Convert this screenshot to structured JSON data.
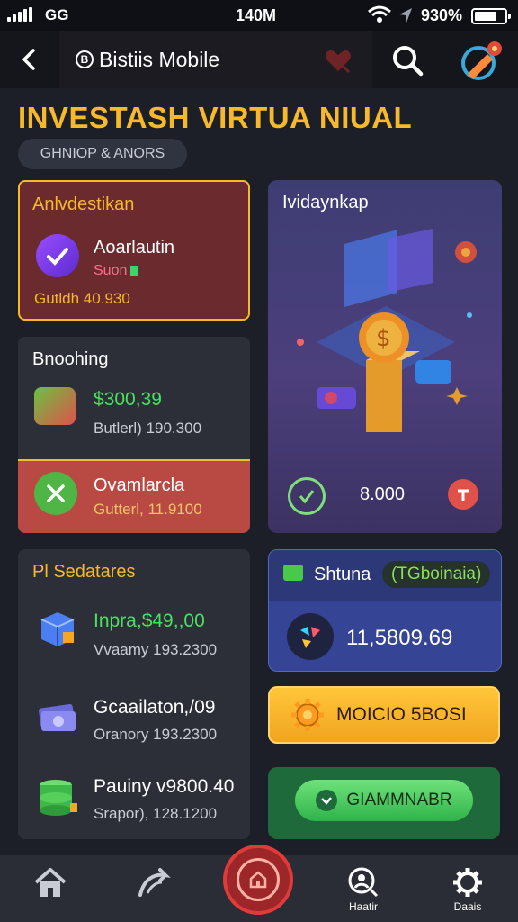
{
  "status_bar": {
    "network": "GG",
    "time": "140M",
    "battery": "930%"
  },
  "app_bar": {
    "title": "Bistiis Mobile",
    "brand_icon": "B"
  },
  "headline": "INVESTASH VIRTUA NIUAL",
  "chip": "GHNIOP & ANORS",
  "invest_card": {
    "title": "Anlvdestikan",
    "name": "Aoarlautin",
    "sub": "Suon",
    "amount": "Gutldh 40.930"
  },
  "big_card": {
    "title": "Ividaynkap",
    "value": "8.000"
  },
  "booking_card": {
    "title": "Bnoohing",
    "value": "$300,39",
    "sub": "Butlerl) 190.300",
    "row2_name": "Ovamlarcla",
    "row2_sub": "Gutterl, 11.9100"
  },
  "stats_card": {
    "title": "Pl Sedatares",
    "items": [
      {
        "name": "Inpra,$49,,00",
        "sub": "Vvaamy 193.2300",
        "icon": "cube-icon"
      },
      {
        "name": "Gcaailaton,/09",
        "sub": "Oranory 193.2300",
        "icon": "cash-stack-icon"
      },
      {
        "name": "Pauiny v9800.40",
        "sub": "Srapor), 128.1200",
        "icon": "coin-stack-icon"
      }
    ]
  },
  "gain_card": {
    "title": "Shtuna",
    "badge": "(TGboinaia)",
    "value": "11,5809.69"
  },
  "gold_button": {
    "label": "MOICIO 5BOSI"
  },
  "green_button": {
    "label": "GIAMMNABR"
  },
  "bottom_nav": {
    "items": [
      {
        "label": "",
        "icon": "home-icon"
      },
      {
        "label": "",
        "icon": "swirl-icon"
      },
      {
        "label": "",
        "icon": "center-home-icon"
      },
      {
        "label": "Haatir",
        "icon": "search-person-icon"
      },
      {
        "label": "Daais",
        "icon": "gear-icon"
      }
    ]
  },
  "colors": {
    "accent": "#f5b92a",
    "positive": "#48e35e",
    "background": "#1c1f27"
  }
}
